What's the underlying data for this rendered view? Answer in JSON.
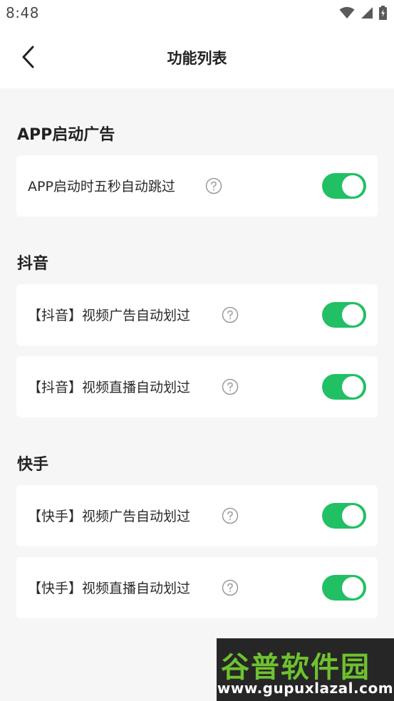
{
  "status_bar": {
    "time": "8:48",
    "icons": [
      "wifi-icon",
      "signal-icon",
      "battery-charging-icon"
    ]
  },
  "header": {
    "back_icon": "back-arrow-icon",
    "title": "功能列表"
  },
  "sections": [
    {
      "title": "APP启动广告",
      "items": [
        {
          "label": "APP启动时五秒自动跳过",
          "help_icon": "help-circle-icon",
          "enabled": true
        }
      ]
    },
    {
      "title": "抖音",
      "items": [
        {
          "label": "【抖音】视频广告自动划过",
          "help_icon": "help-circle-icon",
          "enabled": true
        },
        {
          "label": "【抖音】视频直播自动划过",
          "help_icon": "help-circle-icon",
          "enabled": true
        }
      ]
    },
    {
      "title": "快手",
      "items": [
        {
          "label": "【快手】视频广告自动划过",
          "help_icon": "help-circle-icon",
          "enabled": true
        },
        {
          "label": "【快手】视频直播自动划过",
          "help_icon": "help-circle-icon",
          "enabled": true
        }
      ]
    }
  ],
  "colors": {
    "toggle_on": "#21c064",
    "background": "#f6f6f6",
    "card": "#ffffff"
  },
  "watermark": {
    "title": "谷普软件园",
    "url": "www.gupuxlazal.com"
  }
}
